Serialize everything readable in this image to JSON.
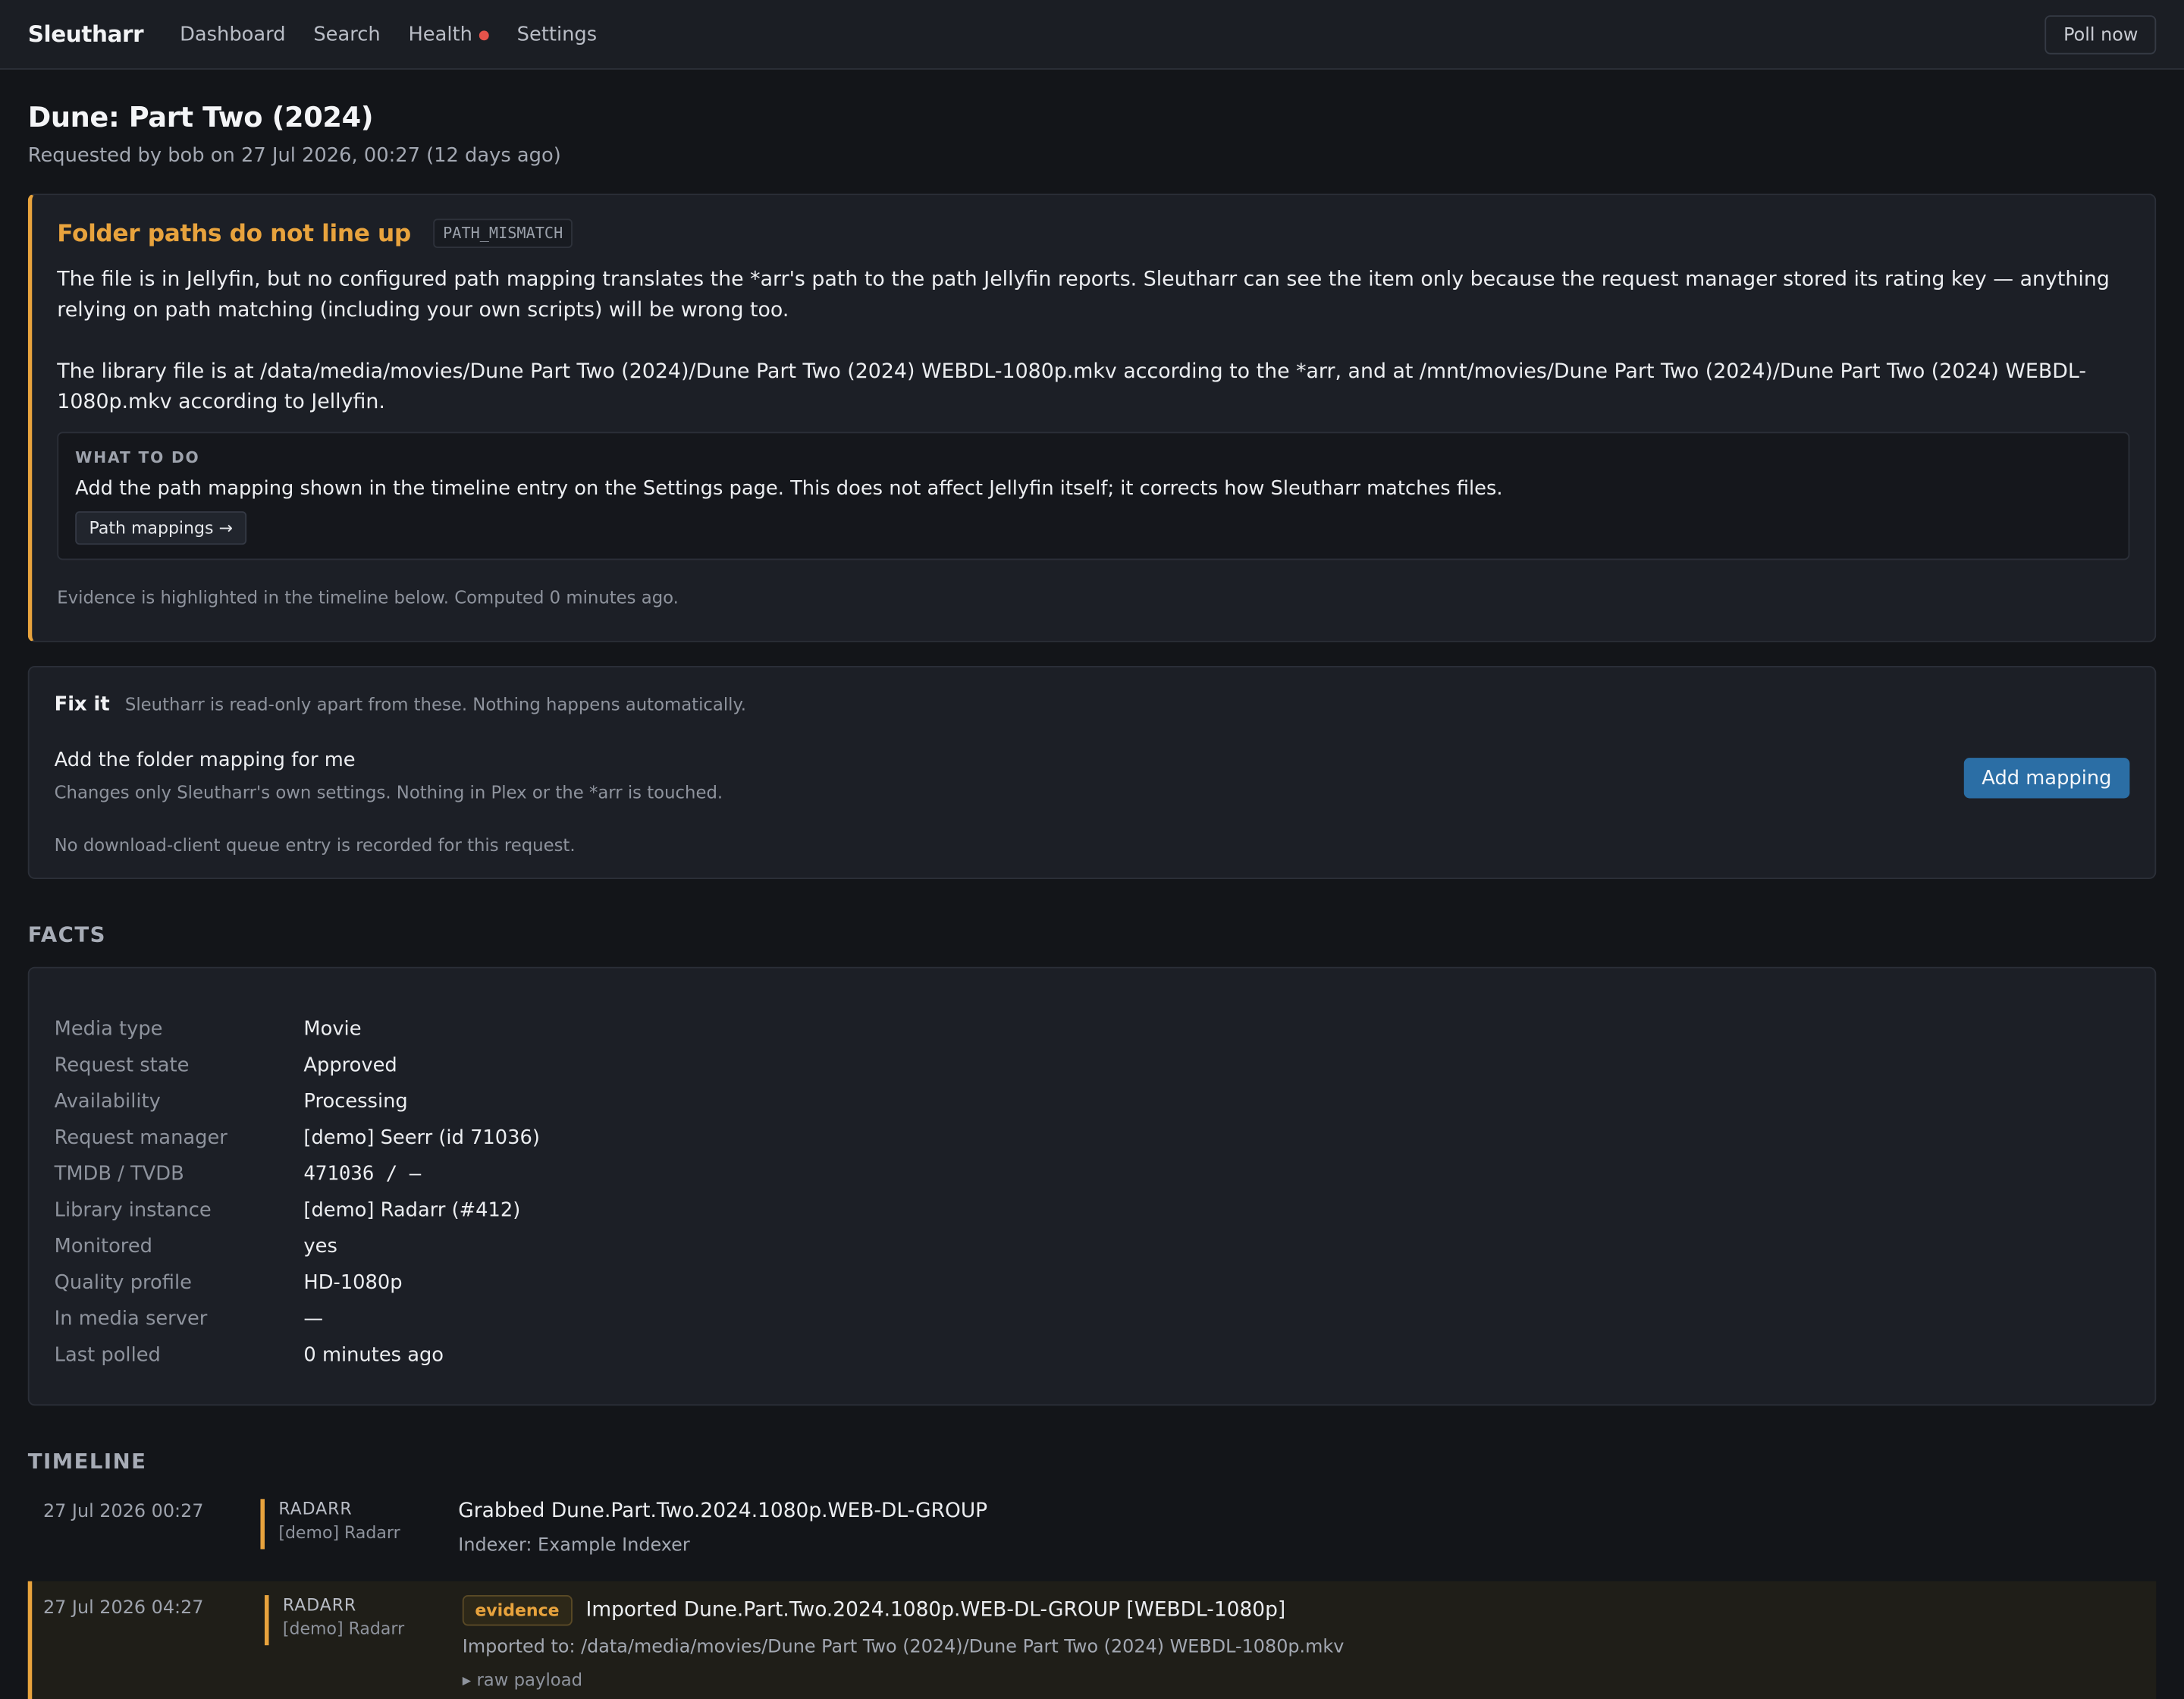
{
  "app": {
    "brand": "Sleutharr",
    "nav": [
      "Dashboard",
      "Search",
      "Health",
      "Settings"
    ],
    "poll_label": "Poll now"
  },
  "page": {
    "title": "Dune: Part Two (2024)",
    "subtitle": "Requested by bob on 27 Jul 2026, 00:27 (12 days ago)"
  },
  "diagnosis": {
    "title": "Folder paths do not line up",
    "code": "PATH_MISMATCH",
    "p1": "The file is in Jellyfin, but no configured path mapping translates the *arr's path to the path Jellyfin reports. Sleutharr can see the item only because the request manager stored its rating key — anything relying on path matching (including your own scripts) will be wrong too.",
    "p2": "The library file is at /data/media/movies/Dune Part Two (2024)/Dune Part Two (2024) WEBDL-1080p.mkv according to the *arr, and at /mnt/movies/Dune Part Two (2024)/Dune Part Two (2024) WEBDL-1080p.mkv according to Jellyfin.",
    "todo_label": "WHAT TO DO",
    "todo_text": "Add the path mapping shown in the timeline entry on the Settings page. This does not affect Jellyfin itself; it corrects how Sleutharr matches files.",
    "todo_button": "Path mappings →",
    "footer": "Evidence is highlighted in the timeline below. Computed 0 minutes ago.",
    "accent": "#e8a33d"
  },
  "fix": {
    "title": "Fix it",
    "note": "Sleutharr is read-only apart from these. Nothing happens automatically.",
    "action_title": "Add the folder mapping for me",
    "action_desc": "Changes only Sleutharr's own settings. Nothing in Plex or the *arr is touched.",
    "button": "Add mapping",
    "none_note": "No download-client queue entry is recorded for this request."
  },
  "facts": {
    "heading": "FACTS",
    "rows": [
      {
        "k": "Media type",
        "v": "Movie"
      },
      {
        "k": "Request state",
        "v": "Approved"
      },
      {
        "k": "Availability",
        "v": "Processing"
      },
      {
        "k": "Request manager",
        "v": "[demo] Seerr (id 71036)"
      },
      {
        "k": "TMDB / TVDB",
        "v": "471036 / —"
      },
      {
        "k": "Library instance",
        "v": "[demo] Radarr (#412)"
      },
      {
        "k": "Monitored",
        "v": "yes"
      },
      {
        "k": "Quality profile",
        "v": "HD-1080p"
      },
      {
        "k": "In media server",
        "v": "—"
      },
      {
        "k": "Last polled",
        "v": "0 minutes ago"
      }
    ]
  },
  "timeline": {
    "heading": "TIMELINE",
    "events": [
      {
        "time": "27 Jul 2026 00:27",
        "source": "RADARR",
        "instance": "[demo] Radarr",
        "title": "Grabbed Dune.Part.Two.2024.1080p.WEB-DL-GROUP",
        "detail": "Indexer: Example Indexer"
      },
      {
        "time": "27 Jul 2026 04:27",
        "source": "RADARR",
        "instance": "[demo] Radarr",
        "badge": "evidence",
        "title": "Imported Dune.Part.Two.2024.1080p.WEB-DL-GROUP [WEBDL-1080p]",
        "detail": "Imported to: /data/media/movies/Dune Part Two (2024)/Dune Part Two (2024) WEBDL-1080p.mkv",
        "raw": "▸ raw payload"
      }
    ]
  }
}
